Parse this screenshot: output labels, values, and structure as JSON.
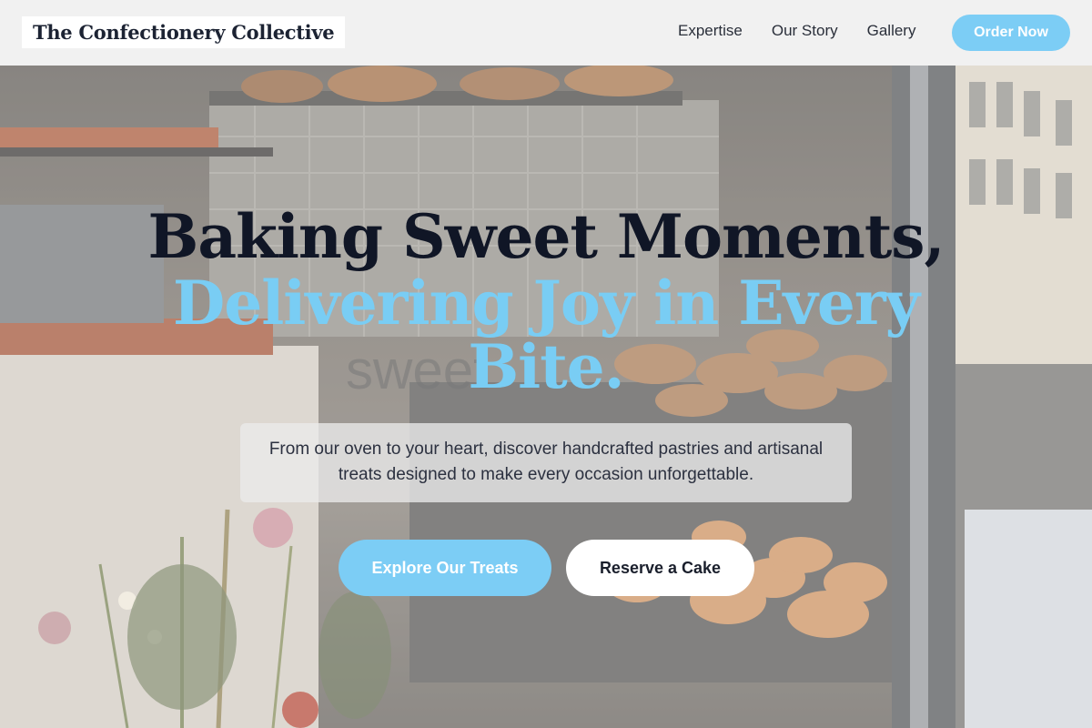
{
  "brand": {
    "name": "The Confectionery Collective"
  },
  "nav": {
    "links": [
      "Expertise",
      "Our Story",
      "Gallery"
    ],
    "cta_label": "Order Now"
  },
  "hero": {
    "title_line1": "Baking Sweet Moments,",
    "title_line2": "Delivering Joy in Every Bite.",
    "background_watermark": "sweet",
    "subtitle": "From our oven to your heart, discover handcrafted pastries and artisanal treats designed to make every occasion unforgettable.",
    "primary_button": "Explore Our Treats",
    "secondary_button": "Reserve a Cake",
    "background_image": "bakery-display-window-photo"
  },
  "colors": {
    "accent": "#7ccdf5",
    "title_dark": "#101626",
    "nav_bg": "#f6f6f6"
  }
}
